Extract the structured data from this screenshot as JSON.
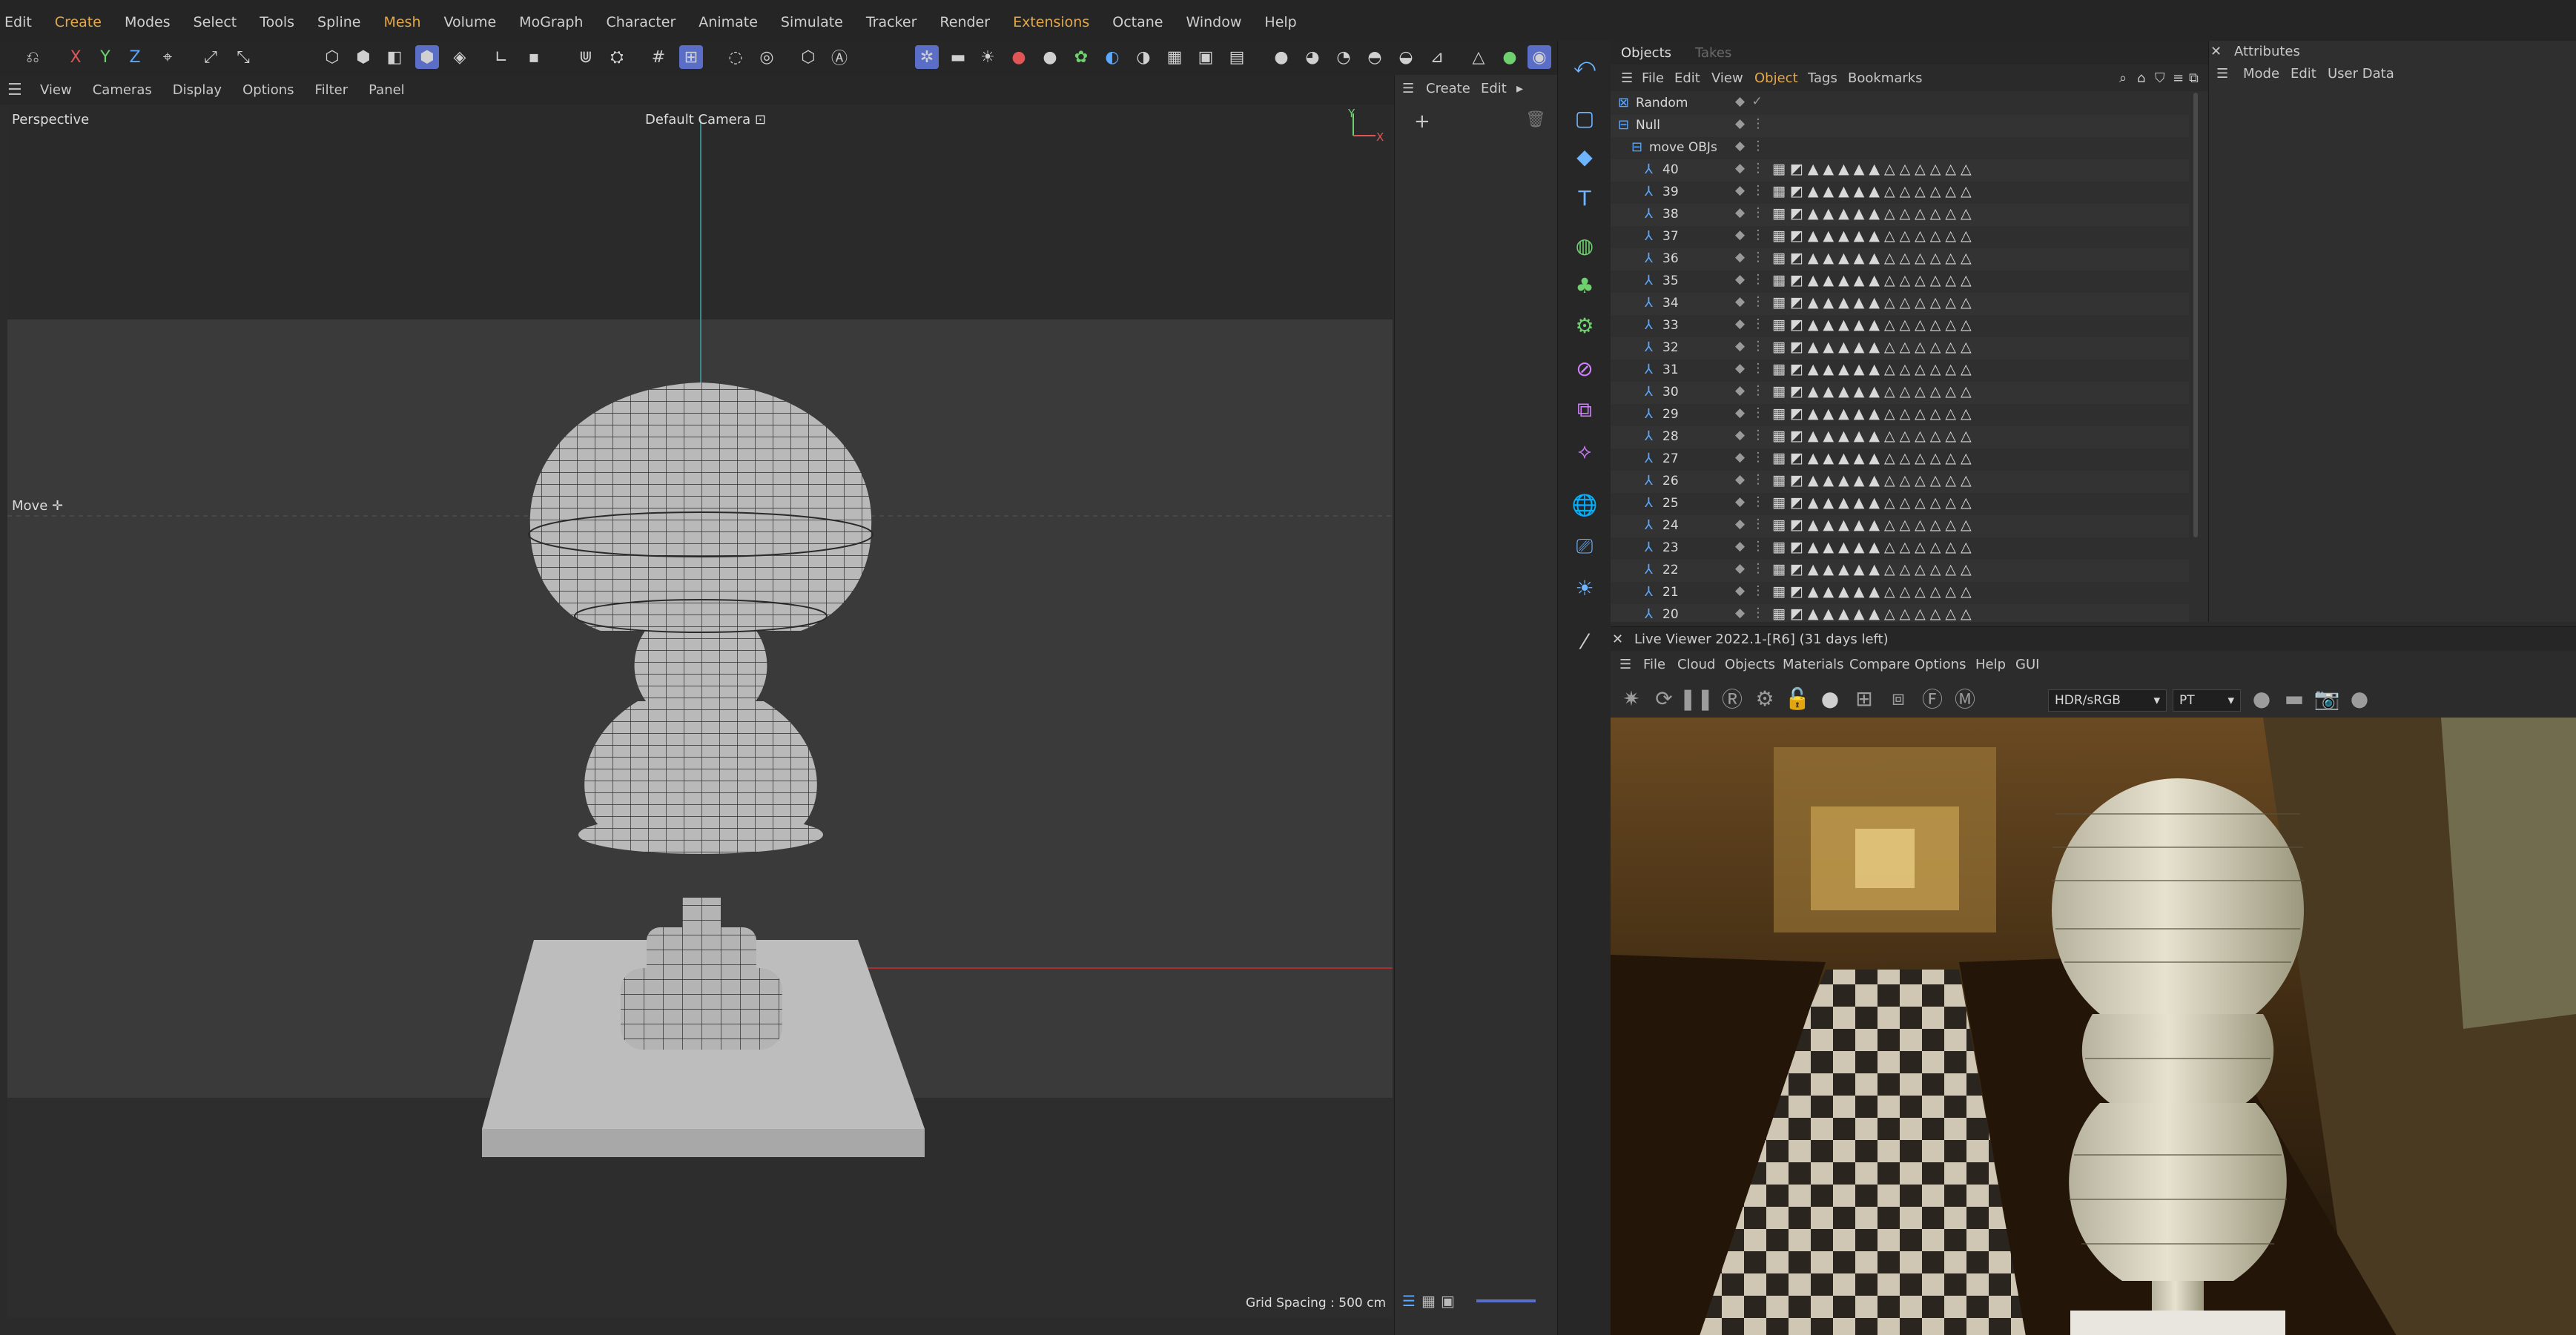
{
  "menubar": [
    "Edit",
    "Create",
    "Modes",
    "Select",
    "Tools",
    "Spline",
    "Mesh",
    "Volume",
    "MoGraph",
    "Character",
    "Animate",
    "Simulate",
    "Tracker",
    "Render",
    "Extensions",
    "Octane",
    "Window",
    "Help"
  ],
  "accent_menus": [
    "Create",
    "Mesh",
    "Extensions"
  ],
  "toolbar": {
    "axis_x": "X",
    "axis_y": "Y",
    "axis_z": "Z"
  },
  "viewport": {
    "menu": [
      "View",
      "Cameras",
      "Display",
      "Options",
      "Filter",
      "Panel"
    ],
    "name": "Perspective",
    "camera": "Default Camera",
    "tool": "Move",
    "grid_spacing": "Grid Spacing : 500 cm",
    "axis_y": "Y",
    "axis_x": "X"
  },
  "create_panel": {
    "create": "Create",
    "edit": "Edit"
  },
  "objects": {
    "tabs": [
      "Objects",
      "Takes"
    ],
    "menu": [
      "File",
      "Edit",
      "View",
      "Object",
      "Tags",
      "Bookmarks"
    ],
    "active_menu": "Object",
    "rows": [
      {
        "name": "Random",
        "indent": 0,
        "tags": false
      },
      {
        "name": "Null",
        "indent": 0,
        "tags": false
      },
      {
        "name": "move OBJs",
        "indent": 1,
        "tags": false
      },
      {
        "name": "40",
        "indent": 2,
        "tags": true
      },
      {
        "name": "39",
        "indent": 2,
        "tags": true
      },
      {
        "name": "38",
        "indent": 2,
        "tags": true
      },
      {
        "name": "37",
        "indent": 2,
        "tags": true
      },
      {
        "name": "36",
        "indent": 2,
        "tags": true
      },
      {
        "name": "35",
        "indent": 2,
        "tags": true
      },
      {
        "name": "34",
        "indent": 2,
        "tags": true
      },
      {
        "name": "33",
        "indent": 2,
        "tags": true
      },
      {
        "name": "32",
        "indent": 2,
        "tags": true
      },
      {
        "name": "31",
        "indent": 2,
        "tags": true
      },
      {
        "name": "30",
        "indent": 2,
        "tags": true
      },
      {
        "name": "29",
        "indent": 2,
        "tags": true
      },
      {
        "name": "28",
        "indent": 2,
        "tags": true
      },
      {
        "name": "27",
        "indent": 2,
        "tags": true
      },
      {
        "name": "26",
        "indent": 2,
        "tags": true
      },
      {
        "name": "25",
        "indent": 2,
        "tags": true
      },
      {
        "name": "24",
        "indent": 2,
        "tags": true
      },
      {
        "name": "23",
        "indent": 2,
        "tags": true
      },
      {
        "name": "22",
        "indent": 2,
        "tags": true
      },
      {
        "name": "21",
        "indent": 2,
        "tags": true
      },
      {
        "name": "20",
        "indent": 2,
        "tags": true
      }
    ]
  },
  "attributes": {
    "title": "Attributes",
    "menu": [
      "Mode",
      "Edit",
      "User Data"
    ]
  },
  "live_viewer": {
    "title": "Live Viewer 2022.1-[R6] (31 days left)",
    "menu": [
      "File",
      "Cloud",
      "Objects",
      "Materials",
      "Compare",
      "Options",
      "Help",
      "GUI"
    ],
    "colorspace": "HDR/sRGB",
    "kernel": "PT"
  },
  "colors": {
    "accent": "#e2a84a",
    "selected": "#5a6ec8",
    "icon_blue": "#5aa8ff"
  }
}
